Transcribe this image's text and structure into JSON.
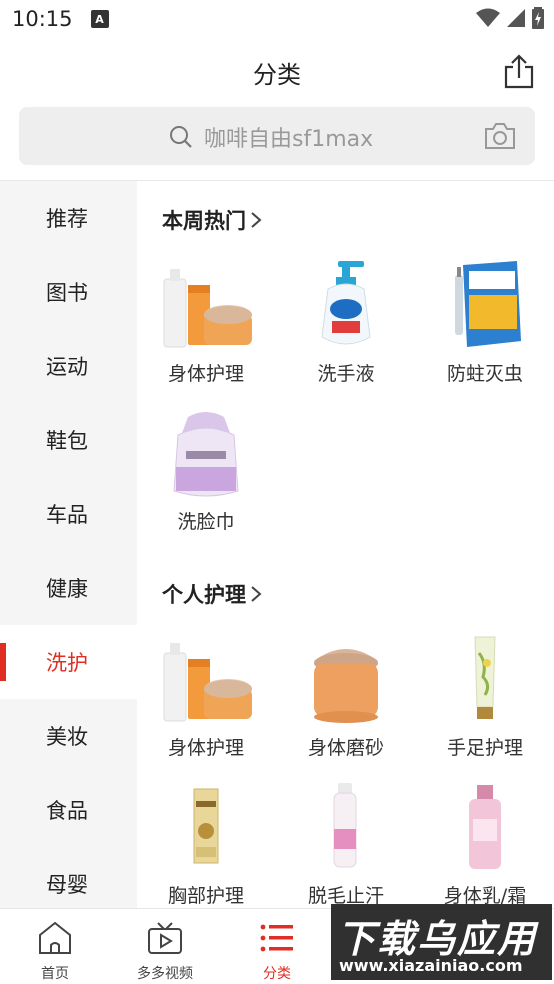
{
  "status": {
    "time": "10:15",
    "app_badge": "A"
  },
  "header": {
    "title": "分类"
  },
  "search": {
    "placeholder": "咖啡自由sf1max"
  },
  "sidebar": {
    "items": [
      {
        "label": "推荐",
        "active": false
      },
      {
        "label": "图书",
        "active": false
      },
      {
        "label": "运动",
        "active": false
      },
      {
        "label": "鞋包",
        "active": false
      },
      {
        "label": "车品",
        "active": false
      },
      {
        "label": "健康",
        "active": false
      },
      {
        "label": "洗护",
        "active": true
      },
      {
        "label": "美妆",
        "active": false
      },
      {
        "label": "食品",
        "active": false
      },
      {
        "label": "母婴",
        "active": false
      }
    ]
  },
  "sections": [
    {
      "title": "本周热门",
      "products": [
        {
          "label": "身体护理",
          "icon": "body-care-set"
        },
        {
          "label": "洗手液",
          "icon": "hand-soap-bottle"
        },
        {
          "label": "防蛀灭虫",
          "icon": "insecticide-box"
        },
        {
          "label": "洗脸巾",
          "icon": "face-towel-roll"
        }
      ]
    },
    {
      "title": "个人护理",
      "products": [
        {
          "label": "身体护理",
          "icon": "body-care-set"
        },
        {
          "label": "身体磨砂",
          "icon": "body-scrub-jar"
        },
        {
          "label": "手足护理",
          "icon": "hand-cream-tube"
        },
        {
          "label": "胸部护理",
          "icon": "breast-care-box"
        },
        {
          "label": "脱毛止汗",
          "icon": "hair-removal-spray"
        },
        {
          "label": "身体乳/霜",
          "icon": "body-lotion-bottle"
        }
      ]
    }
  ],
  "bottom_nav": [
    {
      "label": "首页",
      "icon": "home-icon",
      "active": false
    },
    {
      "label": "多多视频",
      "icon": "video-icon",
      "active": false
    },
    {
      "label": "分类",
      "icon": "category-list-icon",
      "active": true
    }
  ],
  "watermark": {
    "main": "下载乌应用",
    "sub": "www.xiazainiao.com"
  },
  "colors": {
    "accent": "#e02e24",
    "sidebar_bg": "#f5f5f5",
    "search_bg": "#eeeeee"
  }
}
